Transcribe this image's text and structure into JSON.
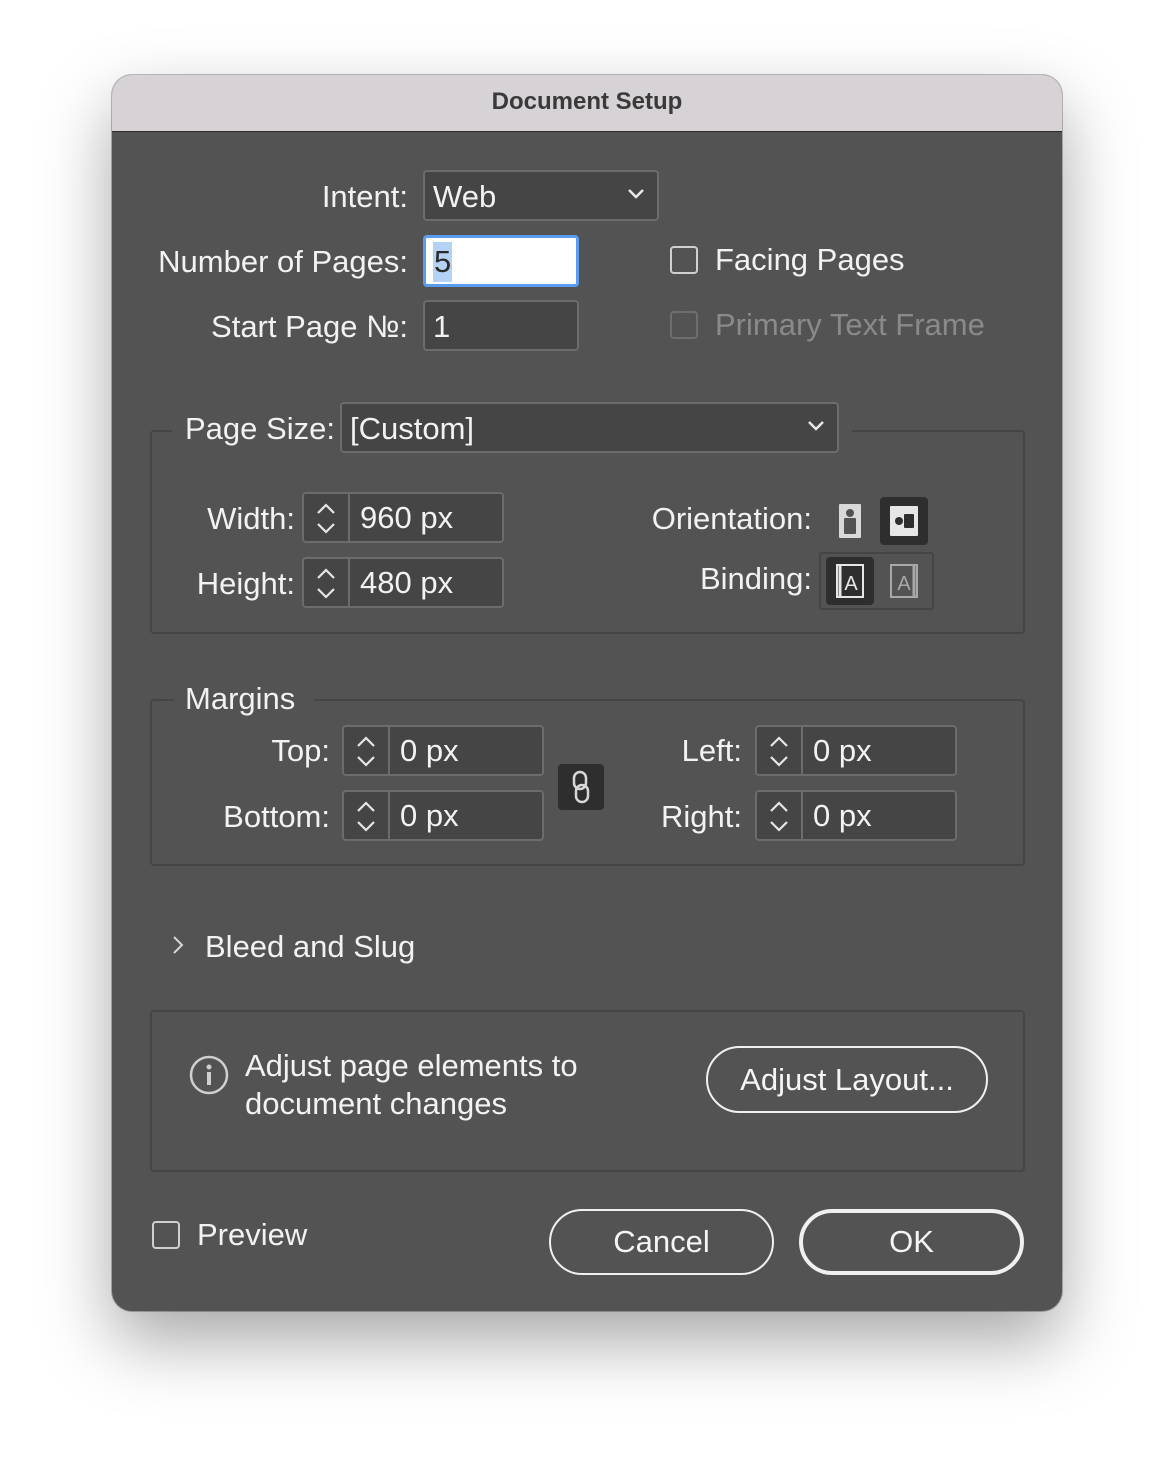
{
  "window": {
    "title": "Document Setup"
  },
  "intent": {
    "label": "Intent:",
    "value": "Web"
  },
  "pages": {
    "label": "Number of Pages:",
    "value": "5"
  },
  "start_page": {
    "label": "Start Page №:",
    "value": "1"
  },
  "facing_pages": {
    "label": "Facing Pages",
    "checked": false
  },
  "primary_text_frame": {
    "label": "Primary Text Frame",
    "checked": false,
    "enabled": false
  },
  "page_size": {
    "label": "Page Size:",
    "value": "[Custom]",
    "width_label": "Width:",
    "width": "960 px",
    "height_label": "Height:",
    "height": "480 px",
    "orientation_label": "Orientation:",
    "orientation_selected": "landscape",
    "binding_label": "Binding:",
    "binding_selected": "left-to-right"
  },
  "margins": {
    "legend": "Margins",
    "top_label": "Top:",
    "top": "0 px",
    "bottom_label": "Bottom:",
    "bottom": "0 px",
    "left_label": "Left:",
    "left": "0 px",
    "right_label": "Right:",
    "right": "0 px",
    "linked": true
  },
  "bleed_slug": {
    "label": "Bleed and Slug",
    "expanded": false
  },
  "adjust": {
    "line1": "Adjust page elements to",
    "line2": "document changes",
    "button": "Adjust Layout..."
  },
  "preview": {
    "label": "Preview",
    "checked": false
  },
  "buttons": {
    "cancel": "Cancel",
    "ok": "OK"
  }
}
